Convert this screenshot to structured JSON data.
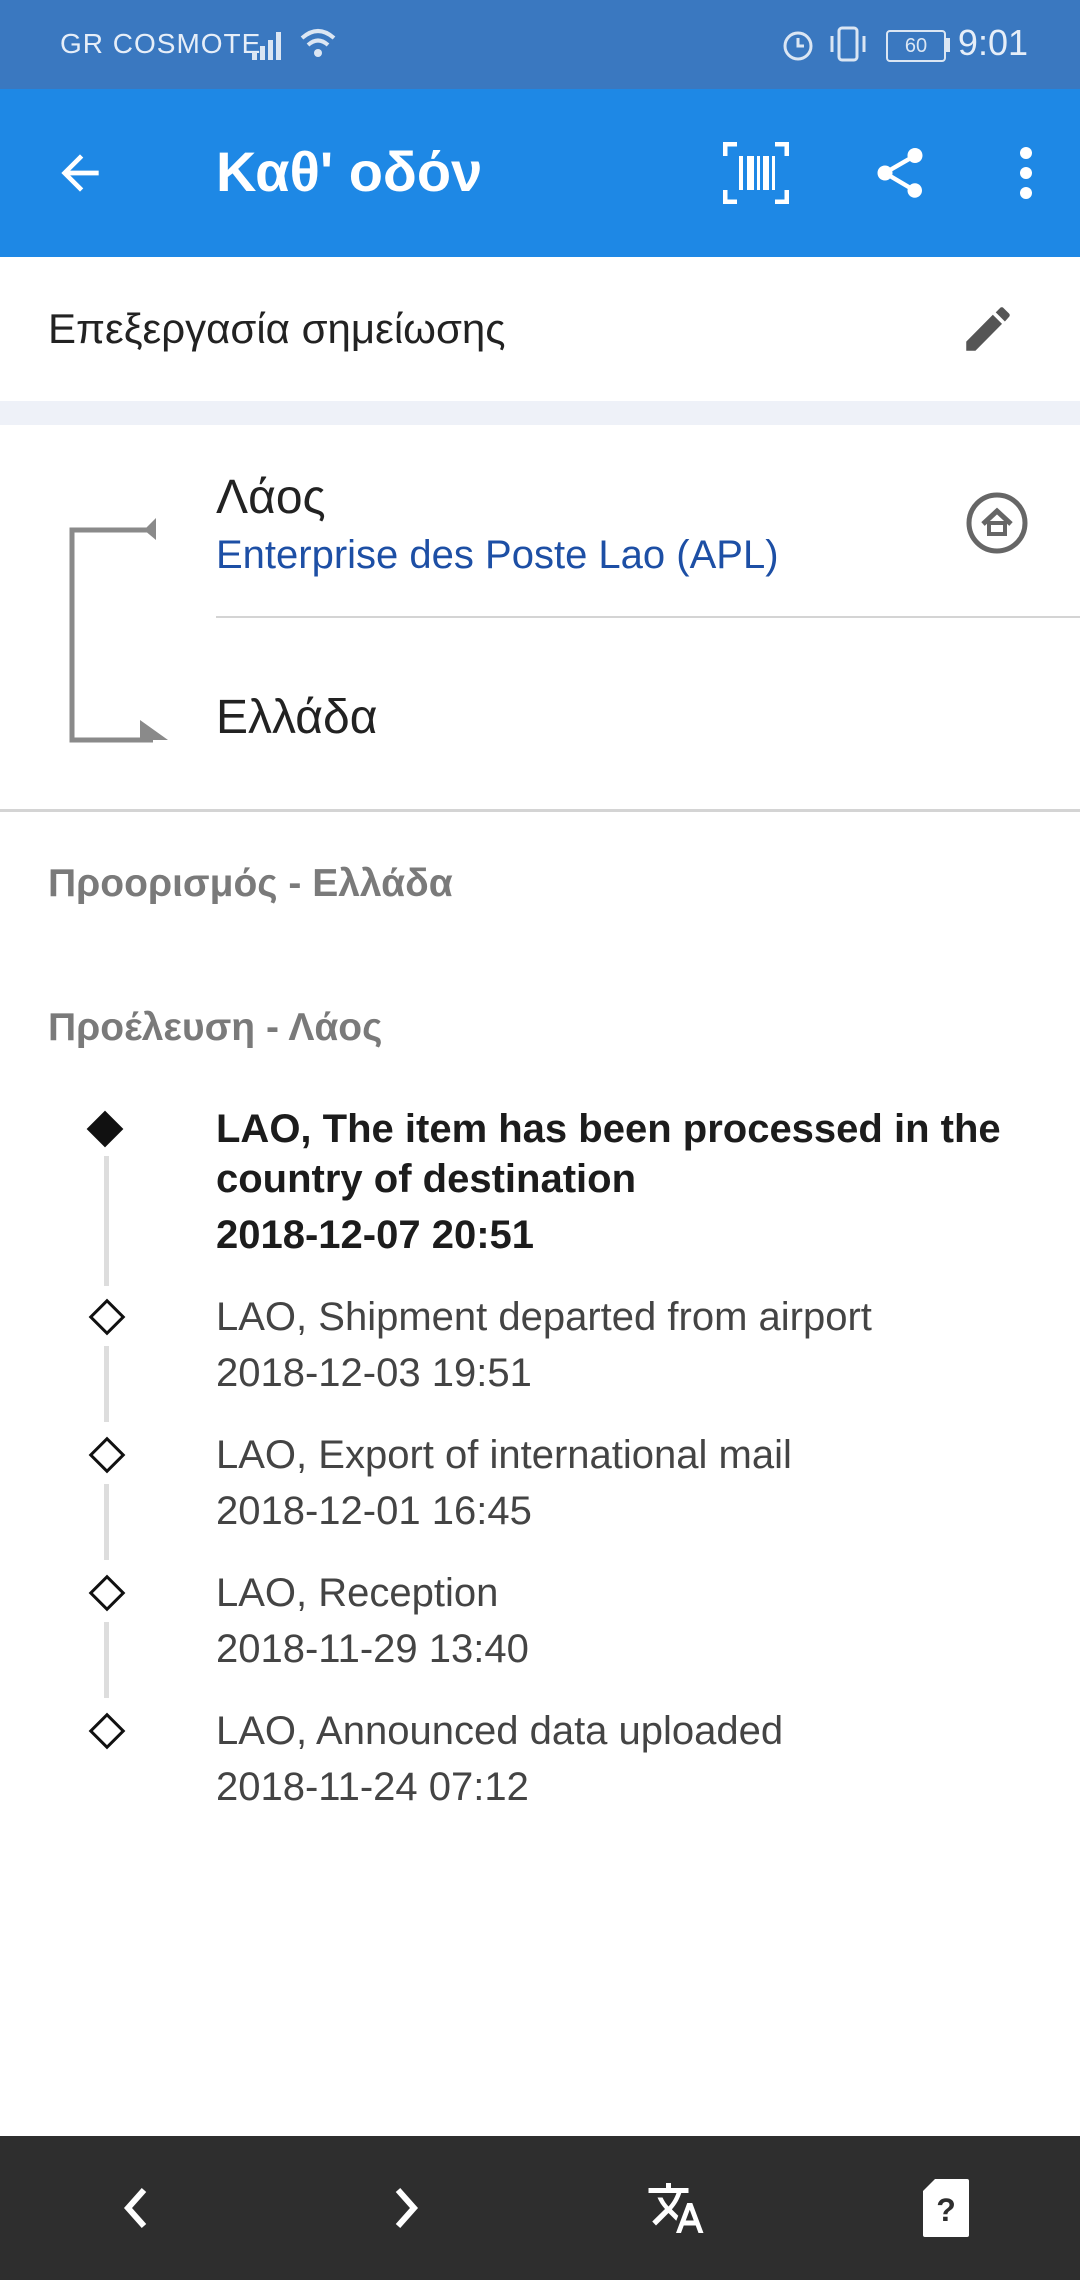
{
  "status_bar": {
    "carrier": "GR COSMOTE",
    "battery": "60",
    "time": "9:01"
  },
  "app_bar": {
    "title": "Καθ' οδόν"
  },
  "note": {
    "label": "Επεξεργασία σημείωσης"
  },
  "route": {
    "origin": "Λάος",
    "carrier": "Enterprise des Poste Lao (APL)",
    "destination": "Ελλάδα"
  },
  "sections": {
    "destination": "Προορισμός - Ελλάδα",
    "origin": "Προέλευση - Λάος"
  },
  "events": [
    {
      "line1": "LAO, The item has been processed in the",
      "line2": "country of destination",
      "date": "2018-12-07 20:51"
    },
    {
      "line1": "LAO, Shipment departed from airport",
      "date": "2018-12-03 19:51"
    },
    {
      "line1": "LAO, Export of international mail",
      "date": "2018-12-01 16:45"
    },
    {
      "line1": "LAO, Reception",
      "date": "2018-11-29 13:40"
    },
    {
      "line1": "LAO, Announced data uploaded",
      "date": "2018-11-24 07:12"
    }
  ],
  "icons": {
    "back": "arrow-left-icon",
    "barcode": "barcode-scan-icon",
    "share": "share-icon",
    "more": "more-vert-icon",
    "edit": "pencil-icon",
    "home": "home-icon"
  },
  "colors": {
    "status_bar": "#3a78c0",
    "app_bar": "#1e88e5",
    "carrier_text": "#1d4fa5",
    "nav_bar": "#2e2e2e"
  }
}
